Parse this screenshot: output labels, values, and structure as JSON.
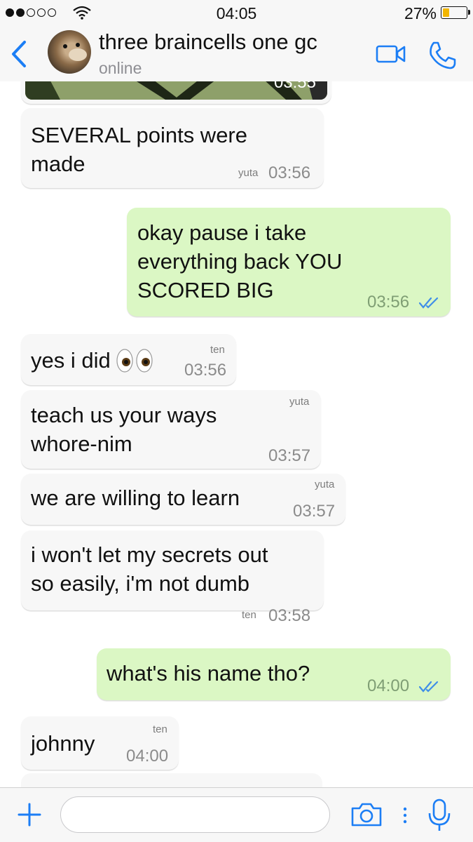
{
  "status_bar": {
    "time": "04:05",
    "battery_percent": "27%",
    "signal_bars_filled": 2,
    "signal_bars_total": 5
  },
  "header": {
    "title": "three braincells one gc",
    "subtitle": "online",
    "accent_color": "#1c7ef5"
  },
  "messages": [
    {
      "type": "image",
      "direction": "in",
      "time": "03:55"
    },
    {
      "direction": "in",
      "text_lines": [
        "SEVERAL points were",
        "made"
      ],
      "sender": "yuta",
      "time": "03:56"
    },
    {
      "direction": "out",
      "text_lines": [
        "okay pause i take",
        "everything back YOU",
        "SCORED BIG"
      ],
      "time": "03:56",
      "status": "read"
    },
    {
      "direction": "in",
      "text_lines": [
        "yes i did"
      ],
      "emoji": "eyes-icon",
      "sender": "ten",
      "time": "03:56"
    },
    {
      "direction": "in",
      "text_lines": [
        "teach us your ways",
        "whore-nim"
      ],
      "sender": "yuta",
      "time": "03:57"
    },
    {
      "direction": "in",
      "text_lines": [
        "we are willing to learn"
      ],
      "sender": "yuta",
      "time": "03:57"
    },
    {
      "direction": "in",
      "text_lines": [
        "i won't let my secrets out",
        "so easily, i'm not dumb"
      ],
      "sender": "ten",
      "time": "03:58"
    },
    {
      "direction": "out",
      "text_lines": [
        "what's his name tho?"
      ],
      "time": "04:00",
      "status": "read"
    },
    {
      "direction": "in",
      "text_lines": [
        "johnny"
      ],
      "sender": "ten",
      "time": "04:00"
    }
  ],
  "input": {
    "value": "",
    "placeholder": ""
  },
  "colors": {
    "incoming_bubble": "#f7f7f7",
    "outgoing_bubble": "#dbf7c4",
    "read_ticks": "#3f8ee8"
  }
}
